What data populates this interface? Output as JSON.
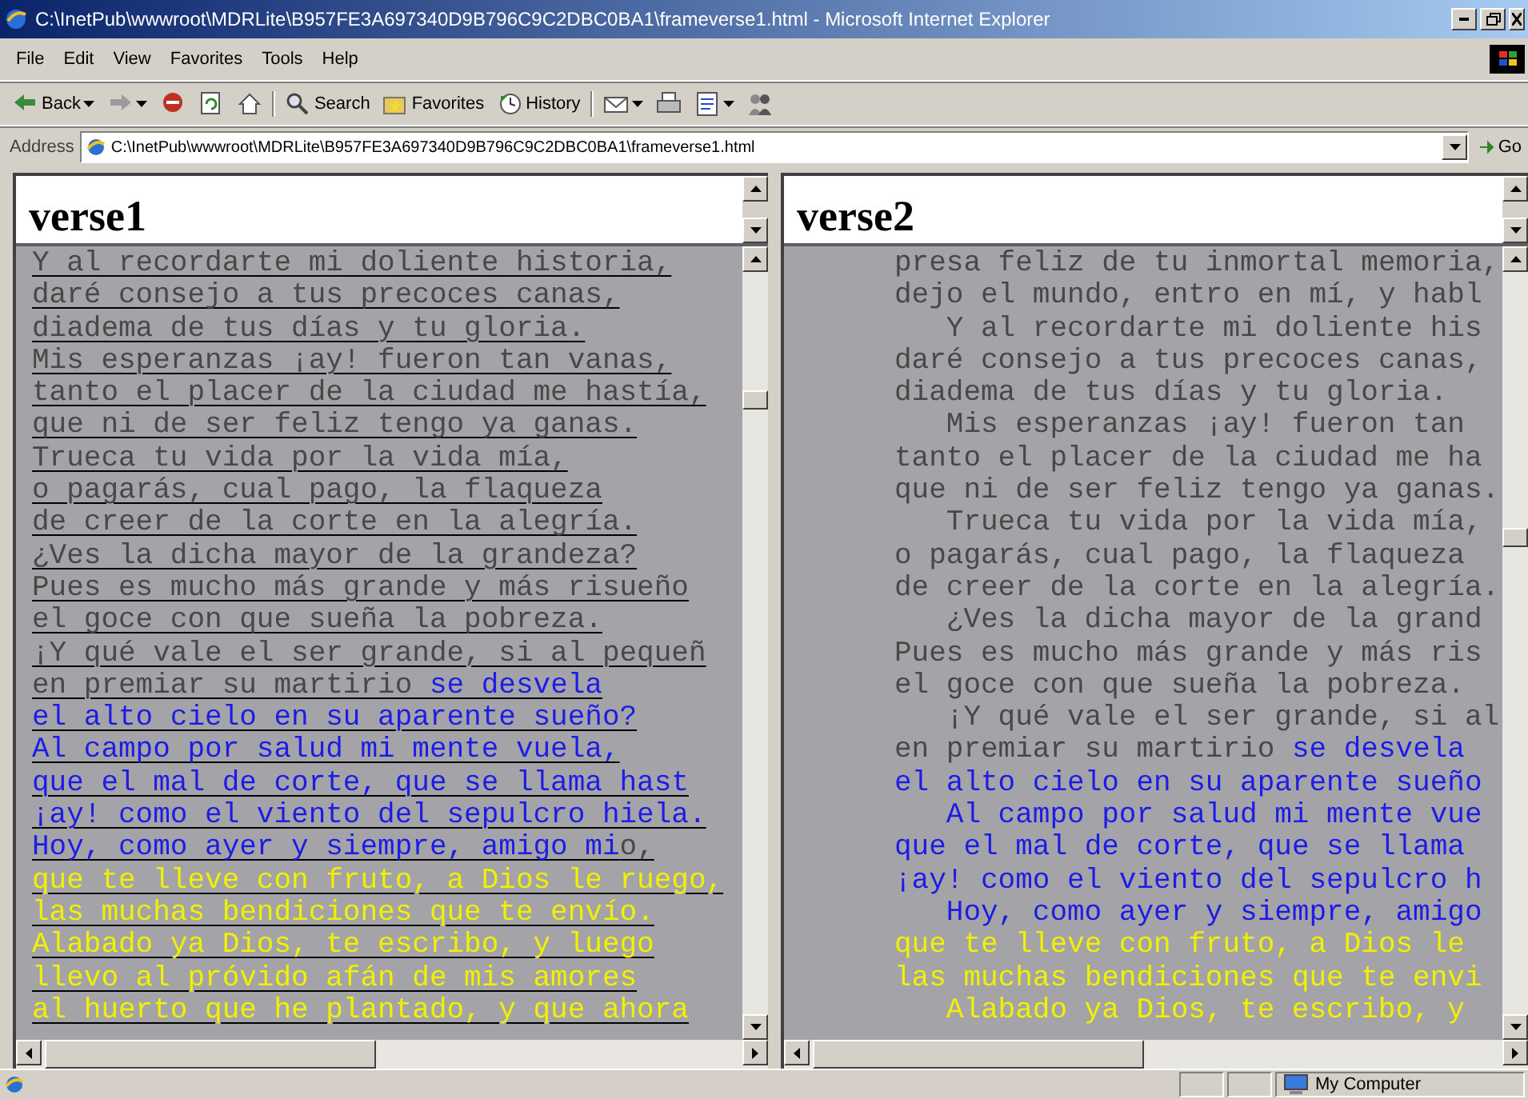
{
  "window": {
    "title": "C:\\InetPub\\wwwroot\\MDRLite\\B957FE3A697340D9B796C9C2DBC0BA1\\frameverse1.html - Microsoft Internet Explorer"
  },
  "menu": [
    "File",
    "Edit",
    "View",
    "Favorites",
    "Tools",
    "Help"
  ],
  "toolbar": [
    {
      "kind": "back",
      "label": "Back"
    },
    {
      "kind": "forward"
    },
    {
      "kind": "stop"
    },
    {
      "kind": "refresh"
    },
    {
      "kind": "home"
    },
    {
      "kind": "search",
      "label": "Search"
    },
    {
      "kind": "favorites",
      "label": "Favorites"
    },
    {
      "kind": "history",
      "label": "History"
    },
    {
      "kind": "mail"
    },
    {
      "kind": "print"
    },
    {
      "kind": "edit"
    },
    {
      "kind": "discuss"
    }
  ],
  "address": {
    "label": "Address",
    "value": "C:\\InetPub\\wwwroot\\MDRLite\\B957FE3A697340D9B796C9C2DBC0BA1\\frameverse1.html",
    "go": "Go"
  },
  "frames": [
    {
      "heading": "verse1",
      "underlined": true,
      "lines": [
        {
          "indent": false,
          "segments": [
            {
              "text": "Y al recordarte mi doliente historia,",
              "color": "#484848"
            }
          ]
        },
        {
          "indent": false,
          "segments": [
            {
              "text": "daré consejo a tus precoces canas,",
              "color": "#484848"
            }
          ]
        },
        {
          "indent": false,
          "segments": [
            {
              "text": "diadema de tus días y tu gloria.",
              "color": "#484848"
            }
          ]
        },
        {
          "indent": false,
          "segments": [
            {
              "text": "Mis esperanzas ¡ay! fueron tan vanas,",
              "color": "#484848"
            }
          ]
        },
        {
          "indent": false,
          "segments": [
            {
              "text": "tanto el placer de la ciudad me hastía,",
              "color": "#484848"
            }
          ]
        },
        {
          "indent": false,
          "segments": [
            {
              "text": "que ni de ser feliz tengo ya ganas.",
              "color": "#484848"
            }
          ]
        },
        {
          "indent": false,
          "segments": [
            {
              "text": "Trueca tu vida por la vida mía,",
              "color": "#484848"
            }
          ]
        },
        {
          "indent": false,
          "segments": [
            {
              "text": "o pagarás, cual pago, la flaqueza",
              "color": "#484848"
            }
          ]
        },
        {
          "indent": false,
          "segments": [
            {
              "text": "de creer de la corte en la alegría.",
              "color": "#484848"
            }
          ]
        },
        {
          "indent": false,
          "segments": [
            {
              "text": "¿Ves la dicha mayor de la grandeza?",
              "color": "#484848"
            }
          ]
        },
        {
          "indent": false,
          "segments": [
            {
              "text": "Pues es mucho más grande y más risueño",
              "color": "#484848"
            }
          ]
        },
        {
          "indent": false,
          "segments": [
            {
              "text": "el goce con que sueña la pobreza.",
              "color": "#484848"
            }
          ]
        },
        {
          "indent": false,
          "segments": [
            {
              "text": "¡Y qué vale el ser grande, si al pequeñ",
              "color": "#484848"
            }
          ]
        },
        {
          "indent": false,
          "segments": [
            {
              "text": "en premiar su martirio ",
              "color": "#484848"
            },
            {
              "text": "se desvela",
              "color": "#1c1ce6"
            }
          ]
        },
        {
          "indent": false,
          "segments": [
            {
              "text": "el alto cielo en su aparente sueño?",
              "color": "#1c1ce6"
            }
          ]
        },
        {
          "indent": false,
          "segments": [
            {
              "text": "Al campo por salud mi mente vuela,",
              "color": "#1c1ce6"
            }
          ]
        },
        {
          "indent": false,
          "segments": [
            {
              "text": "que el mal de corte, que se llama hast",
              "color": "#1c1ce6"
            }
          ]
        },
        {
          "indent": false,
          "segments": [
            {
              "text": "¡ay! como el viento del sepulcro hiela.",
              "color": "#1c1ce6"
            }
          ]
        },
        {
          "indent": false,
          "segments": [
            {
              "text": "Hoy, como ayer y siempre, amigo mi",
              "color": "#1c1ce6"
            },
            {
              "text": "o,",
              "color": "#484848"
            }
          ]
        },
        {
          "indent": false,
          "segments": [
            {
              "text": "que te lleve con fruto, a Dios le ruego,",
              "color": "#f0f000"
            }
          ]
        },
        {
          "indent": false,
          "segments": [
            {
              "text": "las muchas bendiciones que te envío.",
              "color": "#f0f000"
            }
          ]
        },
        {
          "indent": false,
          "segments": [
            {
              "text": "Alabado ya Dios, te escribo, y luego",
              "color": "#f0f000"
            }
          ]
        },
        {
          "indent": false,
          "segments": [
            {
              "text": "llevo al próvido afán de mis amores",
              "color": "#f0f000"
            }
          ]
        },
        {
          "indent": false,
          "segments": [
            {
              "text": "al huerto que he plantado, y que ahora",
              "color": "#f0f000"
            }
          ]
        }
      ]
    },
    {
      "heading": "verse2",
      "underlined": false,
      "lines": [
        {
          "indent": false,
          "segments": [
            {
              "text": "presa feliz de tu inmortal memoria,",
              "color": "#484848"
            }
          ]
        },
        {
          "indent": false,
          "segments": [
            {
              "text": "dejo el mundo, entro en mí, y habl",
              "color": "#484848"
            }
          ]
        },
        {
          "indent": true,
          "segments": [
            {
              "text": "Y al recordarte mi doliente his",
              "color": "#484848"
            }
          ]
        },
        {
          "indent": false,
          "segments": [
            {
              "text": "daré consejo a tus precoces canas,",
              "color": "#484848"
            }
          ]
        },
        {
          "indent": false,
          "segments": [
            {
              "text": "diadema de tus días y tu gloria.",
              "color": "#484848"
            }
          ]
        },
        {
          "indent": true,
          "segments": [
            {
              "text": "Mis esperanzas ¡ay! fueron tan",
              "color": "#484848"
            }
          ]
        },
        {
          "indent": false,
          "segments": [
            {
              "text": "tanto el placer de la ciudad me ha",
              "color": "#484848"
            }
          ]
        },
        {
          "indent": false,
          "segments": [
            {
              "text": "que ni de ser feliz tengo ya ganas.",
              "color": "#484848"
            }
          ]
        },
        {
          "indent": true,
          "segments": [
            {
              "text": "Trueca tu vida por la vida mía,",
              "color": "#484848"
            }
          ]
        },
        {
          "indent": false,
          "segments": [
            {
              "text": "o pagarás, cual pago, la flaqueza",
              "color": "#484848"
            }
          ]
        },
        {
          "indent": false,
          "segments": [
            {
              "text": "de creer de la corte en la alegría.",
              "color": "#484848"
            }
          ]
        },
        {
          "indent": true,
          "segments": [
            {
              "text": "¿Ves la dicha mayor de la grand",
              "color": "#484848"
            }
          ]
        },
        {
          "indent": false,
          "segments": [
            {
              "text": "Pues es mucho más grande y más ris",
              "color": "#484848"
            }
          ]
        },
        {
          "indent": false,
          "segments": [
            {
              "text": "el goce con que sueña la pobreza.",
              "color": "#484848"
            }
          ]
        },
        {
          "indent": true,
          "segments": [
            {
              "text": "¡Y qué vale el ser grande, si al",
              "color": "#484848"
            }
          ]
        },
        {
          "indent": false,
          "segments": [
            {
              "text": "en premiar su martirio ",
              "color": "#484848"
            },
            {
              "text": "se desvela",
              "color": "#1c1ce6"
            }
          ]
        },
        {
          "indent": false,
          "segments": [
            {
              "text": "el alto cielo en su aparente sueño",
              "color": "#1c1ce6"
            }
          ]
        },
        {
          "indent": true,
          "segments": [
            {
              "text": "Al campo por salud mi mente vue",
              "color": "#1c1ce6"
            }
          ]
        },
        {
          "indent": false,
          "segments": [
            {
              "text": "que el mal de corte, que se llama",
              "color": "#1c1ce6"
            }
          ]
        },
        {
          "indent": false,
          "segments": [
            {
              "text": "¡ay! como el viento del sepulcro h",
              "color": "#1c1ce6"
            }
          ]
        },
        {
          "indent": true,
          "segments": [
            {
              "text": "Hoy, como ayer y siempre, amigo",
              "color": "#1c1ce6"
            }
          ]
        },
        {
          "indent": false,
          "segments": [
            {
              "text": "que te lleve con fruto, a Dios le",
              "color": "#f0f000"
            }
          ]
        },
        {
          "indent": false,
          "segments": [
            {
              "text": "las muchas bendiciones que te envi",
              "color": "#f0f000"
            }
          ]
        },
        {
          "indent": true,
          "segments": [
            {
              "text": "Alabado ya Dios, te escribo, y",
              "color": "#f0f000"
            }
          ]
        }
      ]
    }
  ],
  "status_bar": {
    "zone": "My Computer"
  }
}
